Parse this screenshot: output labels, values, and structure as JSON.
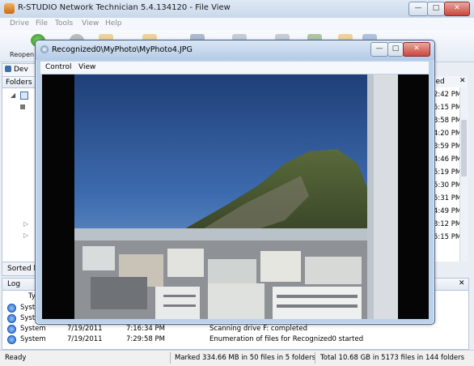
{
  "main_window": {
    "title": "R-STUDIO Network Technician 5.4.134120 - File View",
    "controls": {
      "minimize": "—",
      "maximize": "□",
      "close": "✕"
    }
  },
  "menu": [
    "Drive",
    "File",
    "Tools",
    "View",
    "Help"
  ],
  "toolbar": {
    "reopen_label": "Reopen"
  },
  "left_pane": {
    "devices_tab": "Dev",
    "folders_header": "Folders",
    "sorted_by": "Sorted b"
  },
  "file_list": {
    "header": "ied",
    "times": [
      "2:42 PM",
      "5:15 PM",
      "3:58 PM",
      "4:20 PM",
      "3:59 PM",
      "4:46 PM",
      "5:19 PM",
      "5:30 PM",
      "5:31 PM",
      "4:49 PM",
      "3:12 PM",
      "5:15 PM"
    ]
  },
  "log": {
    "header": "Log",
    "column_type": "Ty",
    "rows": [
      {
        "type": "System",
        "date": "",
        "time": "",
        "message": ""
      },
      {
        "type": "System",
        "date": "",
        "time": "",
        "message": ""
      },
      {
        "type": "System",
        "date": "7/19/2011",
        "time": "7:16:34 PM",
        "message": "Scanning drive F: completed"
      },
      {
        "type": "System",
        "date": "7/19/2011",
        "time": "7:29:58 PM",
        "message": "Enumeration of files for Recognized0 started"
      }
    ]
  },
  "status_bar": {
    "ready": "Ready",
    "marked": "Marked 334.66 MB in 50 files in 5 folders",
    "total": "Total 10.68 GB in 5173 files in 144 folders"
  },
  "viewer": {
    "title": "Recognized0\\MyPhoto\\MyPhoto4.JPG",
    "menu": [
      "Control",
      "View"
    ],
    "controls": {
      "minimize": "—",
      "maximize": "□",
      "close": "✕"
    }
  },
  "colors": {
    "close_button": "#c9463d",
    "accent": "#3b6ea8"
  }
}
